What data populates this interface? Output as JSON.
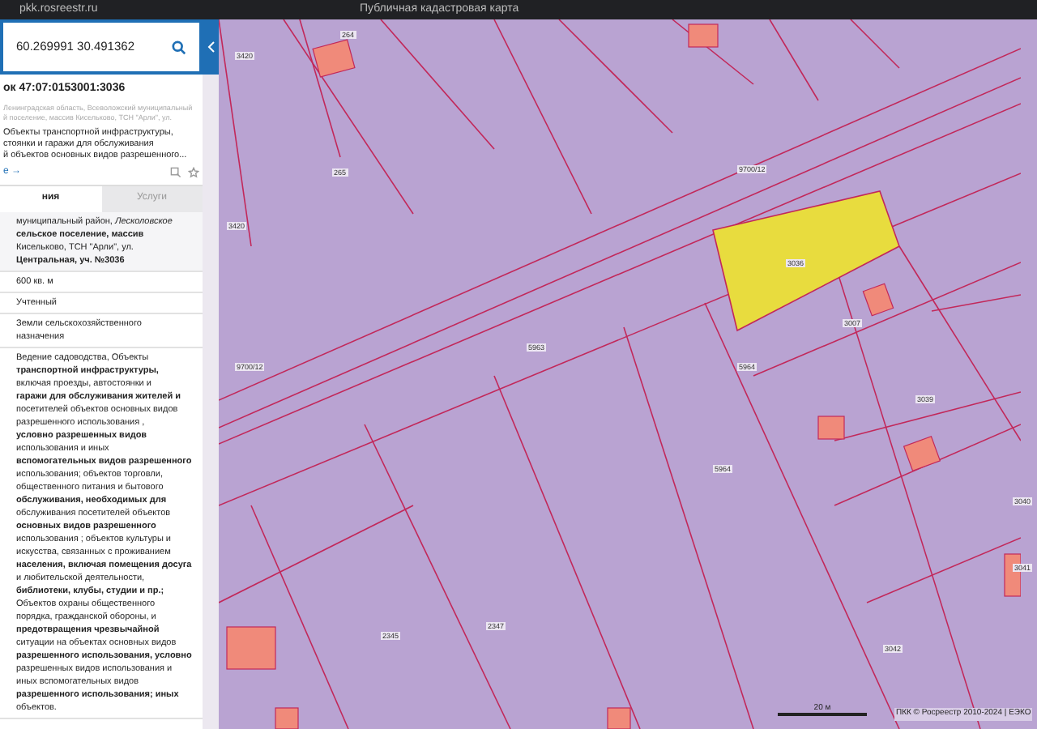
{
  "browser": {
    "url": "pkk.rosreestr.ru",
    "title": "Публичная кадастровая карта"
  },
  "search": {
    "value": "60.269991 30.491362"
  },
  "parcel": {
    "title": "ок 47:07:0153001:3036",
    "address": [
      "Ленинградская область, Всеволожский муниципальный",
      "й поселение, массив Кисельково, ТСН \"Арли\", ул."
    ],
    "description": [
      "Объекты транспортной инфраструктуры,",
      "стоянки и гаражи для обслуживания",
      "й объектов основных видов разрешенного..."
    ],
    "link": "е →"
  },
  "tabs": [
    {
      "label": "ния",
      "selected": true
    },
    {
      "label": "Услуги",
      "selected": false
    }
  ],
  "fields": [
    {
      "kind": "address",
      "lines": [
        "муниципальный район, *Лесколовское*",
        "**сельское поселение, массив**",
        "Кисельково, ТСН \"Арли\", ул.",
        "**Центральная, уч. №3036**"
      ]
    },
    {
      "kind": "plain",
      "lines": [
        "600 кв. м"
      ]
    },
    {
      "kind": "plain",
      "lines": [
        "Учтенный"
      ]
    },
    {
      "kind": "plain",
      "lines": [
        "Земли сельскохозяйственного",
        "назначения"
      ]
    },
    {
      "kind": "plain",
      "lines": [
        "Ведение садоводства, Объекты",
        "**транспортной инфраструктуры,**",
        "включая проезды, автостоянки и",
        "**гаражи для обслуживания жителей и**",
        "посетителей объектов основных видов",
        "разрешенного использования ,",
        "**условно разрешенных видов**",
        "использования и иных",
        "**вспомогательных видов разрешенного**",
        "использования; объектов торговли,",
        "общественного питания и бытового",
        "**обслуживания, необходимых для**",
        "обслуживания посетителей объектов",
        "**основных видов разрешенного**",
        "использования ; объектов культуры и",
        "искусства, связанных с проживанием",
        "**населения, включая помещения досуга**",
        "и любительской деятельности,",
        "**библиотеки, клубы, студии и пр.;**",
        "Объектов охраны общественного",
        "порядка, гражданской обороны, и",
        "**предотвращения чрезвычайной**",
        "ситуации на объектах основных видов",
        "**разрешенного использования, условно**",
        "разрешенных видов использования и",
        "иных вспомогательных видов",
        "**разрешенного использования; иных**",
        "объектов."
      ]
    }
  ],
  "map": {
    "labels": [
      "264",
      "265",
      "3420",
      "5963",
      "5964",
      "5964",
      "3007",
      "3036",
      "3039",
      "3040",
      "3041",
      "3042",
      "2345",
      "2347",
      "9700/12",
      "9700/12",
      "3420"
    ],
    "scale": "20 м",
    "copyright": "ПКК © Росреестр 2010-2024 | ЕЭКО"
  }
}
